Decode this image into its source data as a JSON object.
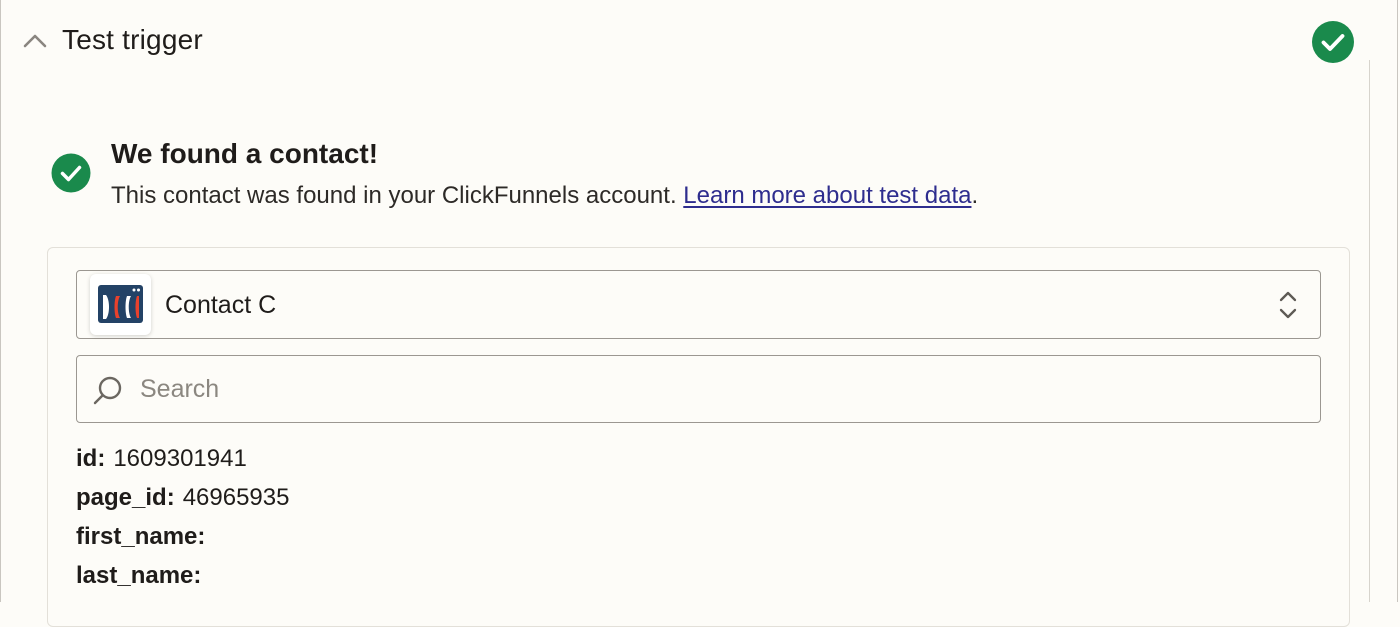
{
  "header": {
    "title": "Test trigger",
    "status_icon": "check-circle-icon",
    "collapse_icon": "chevron-up-icon"
  },
  "result": {
    "title": "We found a contact!",
    "description": "This contact was found in your ClickFunnels account.",
    "link_label": "Learn more about test data",
    "trailing": "."
  },
  "record_select": {
    "app_icon": "clickfunnels-logo",
    "selected": "Contact C"
  },
  "search": {
    "placeholder": "Search",
    "value": ""
  },
  "fields": [
    {
      "key": "id:",
      "value": "1609301941"
    },
    {
      "key": "page_id:",
      "value": "46965935"
    },
    {
      "key": "first_name:",
      "value": ""
    },
    {
      "key": "last_name:",
      "value": ""
    }
  ],
  "colors": {
    "success": "#1a8a4c",
    "link": "#2e2d8e",
    "brand_blue": "#234266",
    "brand_red": "#e8412c"
  }
}
